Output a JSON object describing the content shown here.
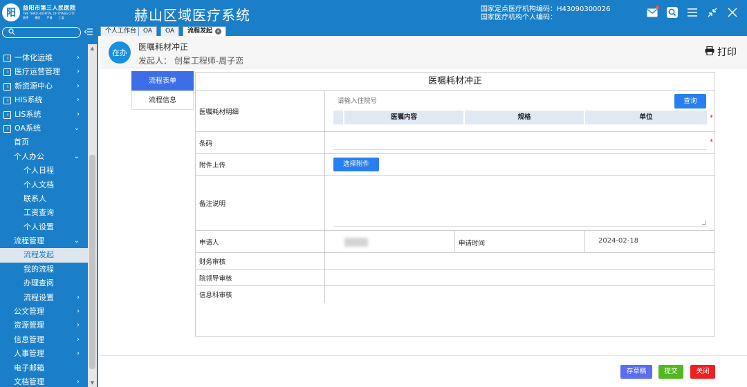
{
  "header": {
    "logo": {
      "glyph": "阳",
      "name_cn": "益阳市第三人民医院",
      "name_en": "THE THIRD HOSPITAL OF YIYANG CITY",
      "sub": "医德 精医 严谨 仁爱"
    },
    "system_title": "赫山区域医疗系统",
    "org_code": "国家定点医疗机构编码：H43090300026",
    "person_code": "国家医疗机构个人编码：",
    "icons": [
      "mail-icon",
      "search-icon",
      "menu-icon",
      "shrink-icon",
      "close-icon"
    ],
    "accent_color": "#1a7fc8"
  },
  "sidebar": {
    "search_placeholder": "",
    "items": [
      {
        "label": "一体化运维",
        "level": 0,
        "arrow": "›"
      },
      {
        "label": "医疗运营管理",
        "level": 0,
        "arrow": "›"
      },
      {
        "label": "新资源中心",
        "level": 0,
        "arrow": "›"
      },
      {
        "label": "HIS系统",
        "level": 0,
        "arrow": "›"
      },
      {
        "label": "LIS系统",
        "level": 0,
        "arrow": "›"
      },
      {
        "label": "OA系统",
        "level": 0,
        "arrow": "⌄"
      },
      {
        "label": "首页",
        "level": 1,
        "arrow": ""
      },
      {
        "label": "个人办公",
        "level": 1,
        "arrow": "⌄"
      },
      {
        "label": "个人日程",
        "level": 2,
        "arrow": ""
      },
      {
        "label": "个人文档",
        "level": 2,
        "arrow": ""
      },
      {
        "label": "联系人",
        "level": 2,
        "arrow": ""
      },
      {
        "label": "工资查询",
        "level": 2,
        "arrow": ""
      },
      {
        "label": "个人设置",
        "level": 2,
        "arrow": ""
      },
      {
        "label": "流程管理",
        "level": 1,
        "arrow": "⌄"
      },
      {
        "label": "流程发起",
        "level": 2,
        "arrow": "",
        "active": true
      },
      {
        "label": "我的流程",
        "level": 2,
        "arrow": ""
      },
      {
        "label": "办理查阅",
        "level": 2,
        "arrow": ""
      },
      {
        "label": "流程设置",
        "level": 2,
        "arrow": "›"
      },
      {
        "label": "公文管理",
        "level": 1,
        "arrow": "›"
      },
      {
        "label": "资源管理",
        "level": 1,
        "arrow": "›"
      },
      {
        "label": "信息管理",
        "level": 1,
        "arrow": "›"
      },
      {
        "label": "人事管理",
        "level": 1,
        "arrow": "›"
      },
      {
        "label": "电子邮箱",
        "level": 1,
        "arrow": ""
      },
      {
        "label": "文档管理",
        "level": 1,
        "arrow": "›"
      }
    ]
  },
  "tabs": [
    {
      "label": "个人工作台",
      "active": false
    },
    {
      "label": "OA",
      "active": false
    },
    {
      "label": "OA",
      "active": false
    },
    {
      "label": "流程发起",
      "active": true
    }
  ],
  "process": {
    "status": "在办",
    "title": "医嘱耗材冲正",
    "initiator": "发起人：  创星工程师-周子恋",
    "print_label": "打印"
  },
  "side_tabs": [
    {
      "label": "流程表单",
      "active": true
    },
    {
      "label": "流程信息",
      "active": false
    }
  ],
  "form": {
    "title": "医嘱耗材冲正",
    "detail_label": "医嘱耗材明细",
    "inpatient_placeholder": "请输入住院号",
    "query_button": "查询",
    "detail_columns": [
      "",
      "医嘱内容",
      "规格",
      "单位"
    ],
    "barcode_label": "条码",
    "attachment_label": "附件上传",
    "choose_attachment_button": "选择附件",
    "remark_label": "备注说明",
    "applicant_label": "申请人",
    "apply_time_label": "申请时间",
    "apply_time_value": "2024-02-18",
    "finance_review_label": "财务审核",
    "leader_review_label": "院领导审核",
    "info_review_label": "信息科审核",
    "required_mark": "*"
  },
  "footer": {
    "save_draft": "存草稿",
    "submit": "提交",
    "close": "关闭",
    "colors": {
      "save_draft": "#5a6ef0",
      "submit": "#52b81f",
      "close": "#f02020"
    }
  }
}
